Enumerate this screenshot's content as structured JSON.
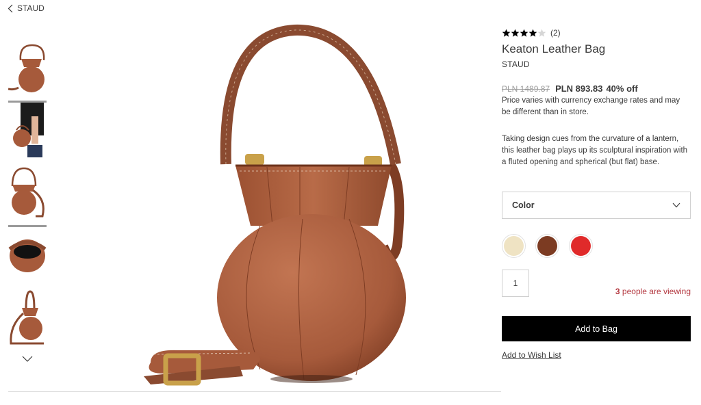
{
  "breadcrumb": {
    "label": "STAUD"
  },
  "rating": {
    "stars": 4,
    "max": 5,
    "count": "(2)"
  },
  "product": {
    "title": "Keaton Leather Bag",
    "brand": "STAUD",
    "old_price": "PLN 1489.87",
    "new_price": "PLN 893.83",
    "discount": "40% off",
    "price_note": "Price varies with currency exchange rates and may be different than in store.",
    "description": "Taking design cues from the curvature of a lantern, this leather bag plays up its sculptural inspiration with a fluted opening and spherical (but flat) base."
  },
  "color_select": {
    "label": "Color"
  },
  "swatches": [
    {
      "name": "cream",
      "color": "#efe3c3"
    },
    {
      "name": "brown",
      "color": "#7c3b22"
    },
    {
      "name": "red",
      "color": "#e02a2a"
    }
  ],
  "quantity": {
    "value": "1"
  },
  "viewing": {
    "count": "3",
    "text": " people are viewing"
  },
  "actions": {
    "add_to_bag": "Add to Bag",
    "wish_list": "Add to Wish List"
  },
  "colors": {
    "leather": "#a65a3b",
    "accent_red": "#b3373f",
    "button_bg": "#000000"
  }
}
